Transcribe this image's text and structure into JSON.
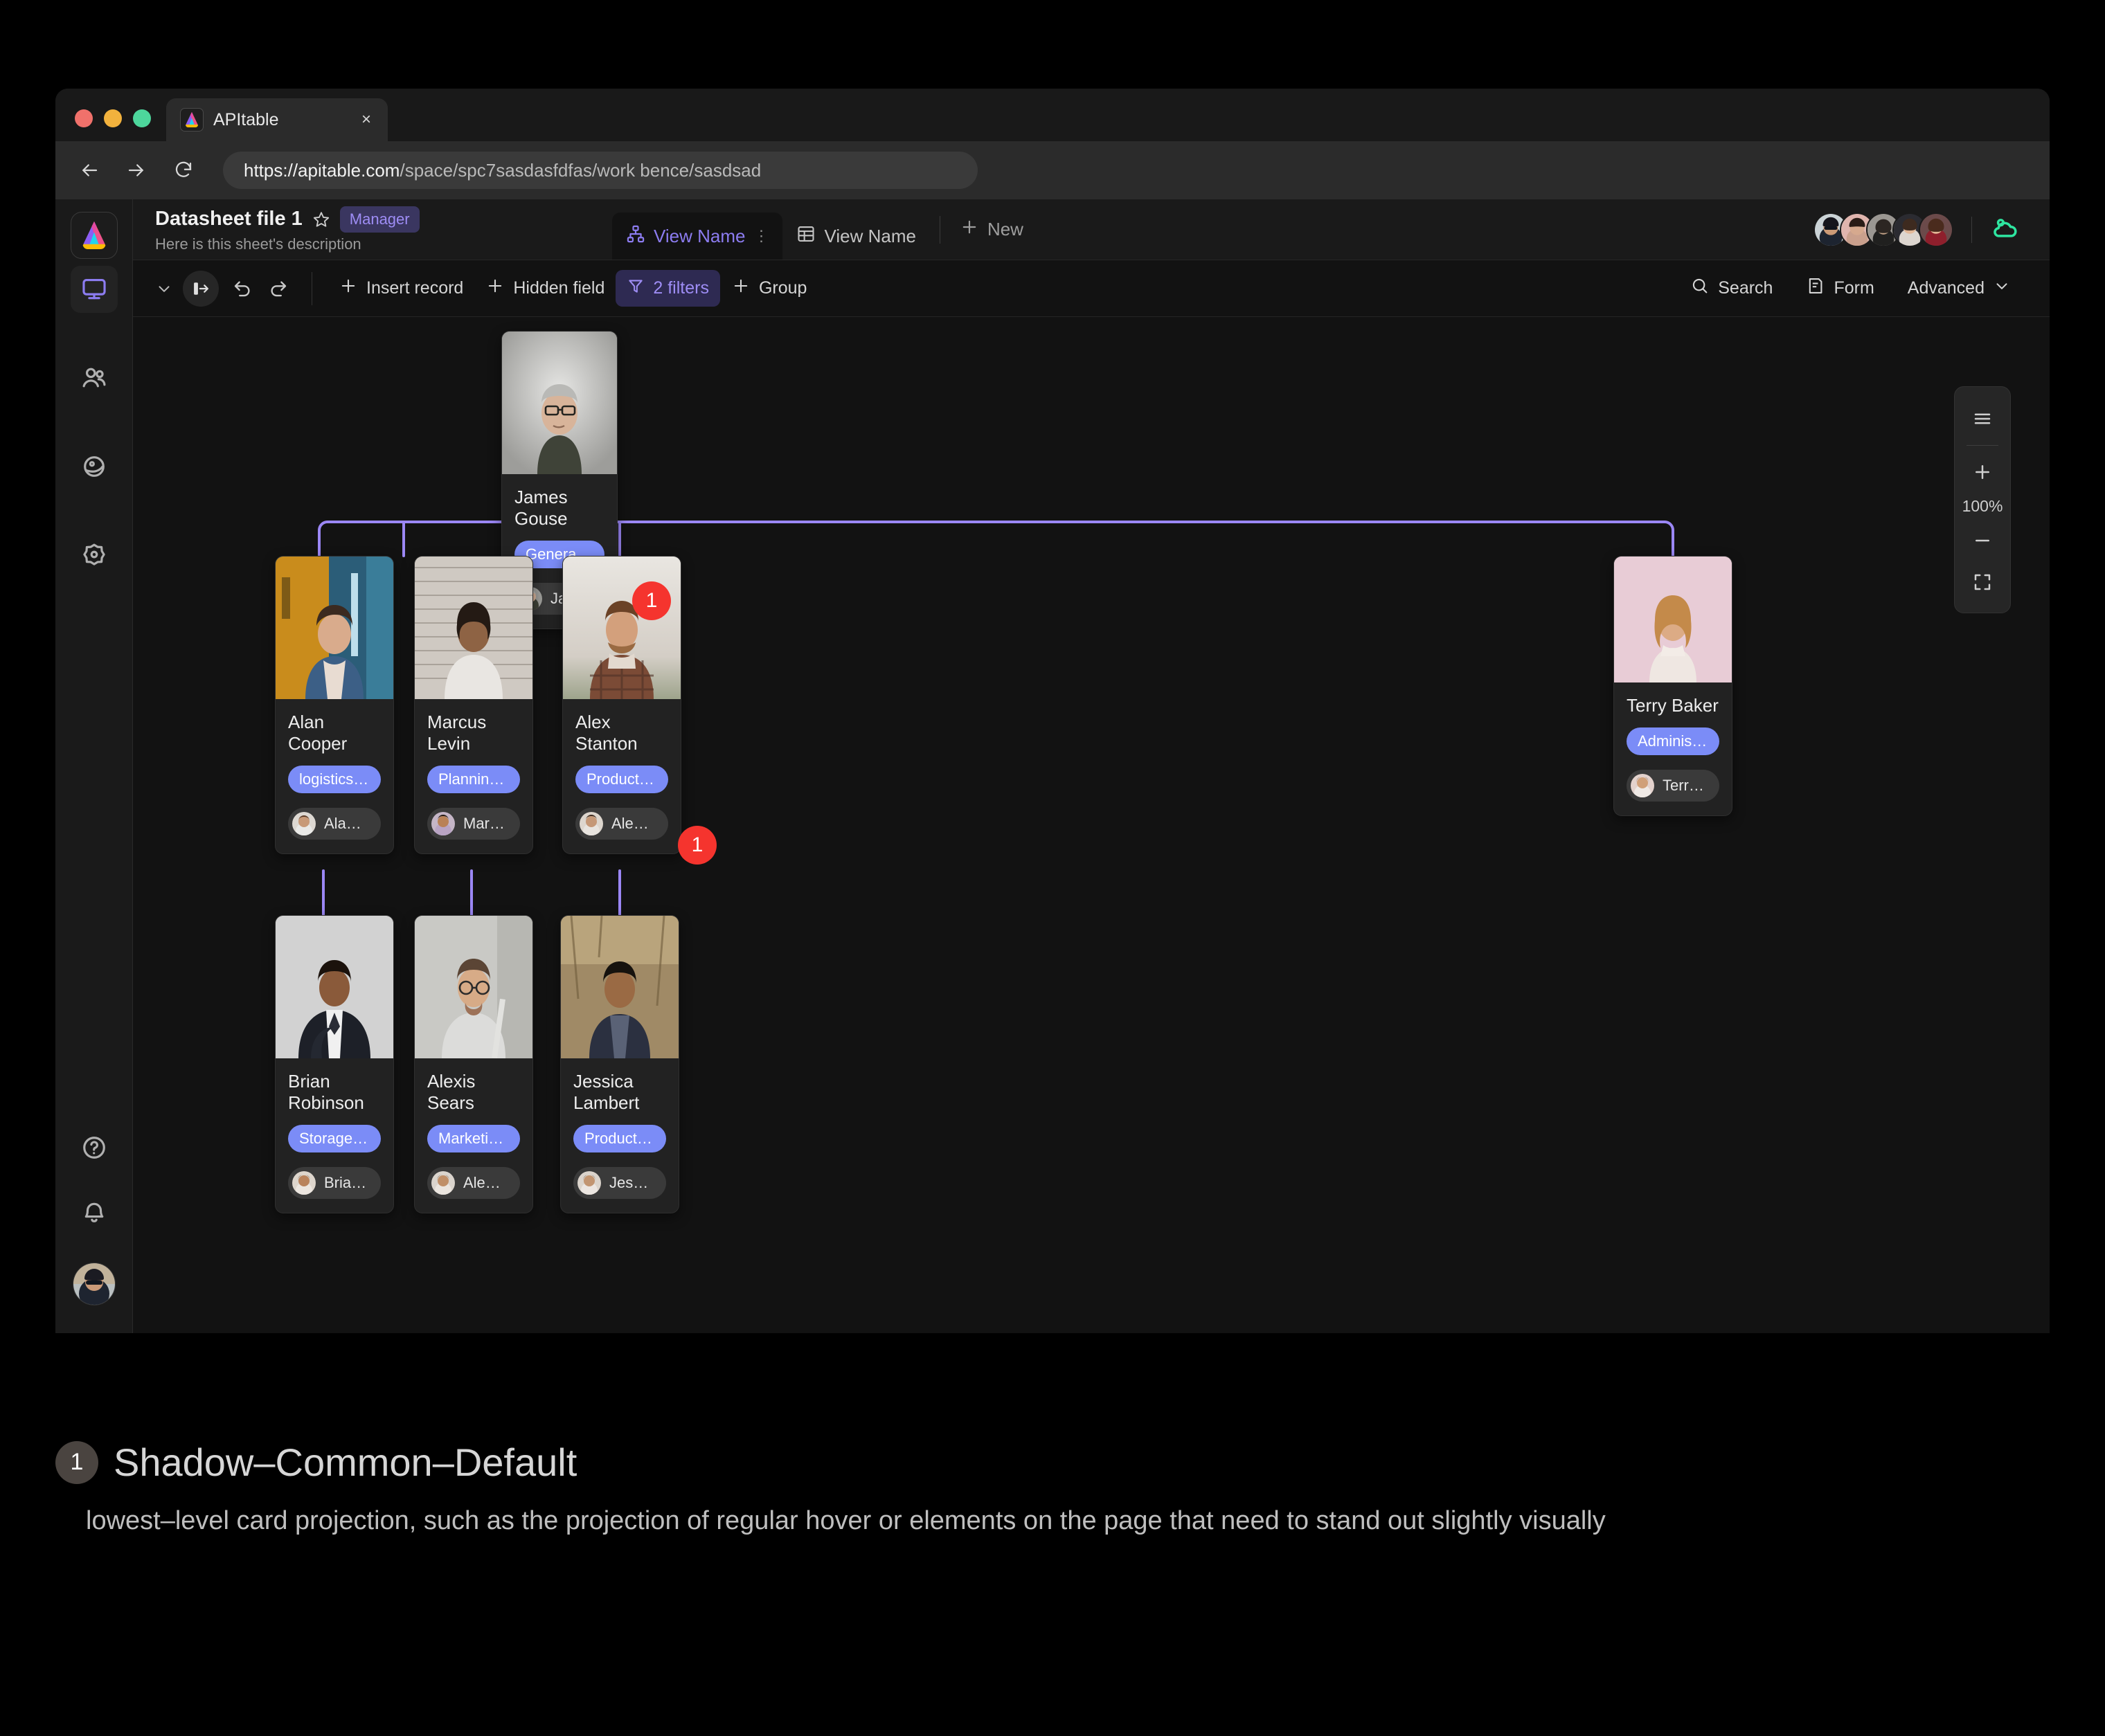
{
  "browser": {
    "tab": {
      "title": "APItable",
      "favicon": "apitable-logo-icon",
      "close": "×"
    },
    "nav": {
      "back": "back-arrow-icon",
      "forward": "forward-arrow-icon",
      "reload": "reload-icon"
    },
    "url": {
      "strong": "https://apitable.com",
      "rest": "/space/spc7sasdasfdfas/work bence/sasdsad"
    }
  },
  "rail": {
    "items": [
      {
        "name": "workbench",
        "icon": "monitor-icon",
        "active": true
      },
      {
        "name": "contacts",
        "icon": "people-icon",
        "active": false
      },
      {
        "name": "space",
        "icon": "planet-icon",
        "active": false
      },
      {
        "name": "settings",
        "icon": "gear-icon",
        "active": false
      }
    ],
    "bottom": [
      {
        "name": "help",
        "icon": "question-circle-icon"
      },
      {
        "name": "notifications",
        "icon": "bell-icon"
      }
    ]
  },
  "header": {
    "sheet_title": "Datasheet file 1",
    "star": "star-icon",
    "role_badge": "Manager",
    "description": "Here is this sheet's description",
    "view_tabs": [
      {
        "label": "View Name",
        "icon": "org-chart-icon",
        "active": true,
        "menu": "⋮"
      },
      {
        "label": "View Name",
        "icon": "grid-icon",
        "active": false
      }
    ],
    "new_view": {
      "label": "New",
      "icon": "plus-icon"
    },
    "collaborators_count": 5,
    "cloud_status_icon": "cloud-saved-icon",
    "cloud_color": "#2ee5a0"
  },
  "toolbar": {
    "chevron": "chevron-down-icon",
    "collapse": "collapse-panel-icon",
    "undo": "undo-icon",
    "redo": "redo-icon",
    "left_buttons": [
      {
        "label": "Insert record",
        "icon": "plus-icon",
        "accent": false
      },
      {
        "label": "Hidden field",
        "icon": "plus-icon",
        "accent": false
      },
      {
        "label": "2 filters",
        "icon": "filter-icon",
        "accent": true
      },
      {
        "label": "Group",
        "icon": "plus-icon",
        "accent": false
      }
    ],
    "right_buttons": [
      {
        "label": "Search",
        "icon": "search-icon"
      },
      {
        "label": "Form",
        "icon": "form-icon"
      },
      {
        "label": "Advanced",
        "icon": "chevron-down-icon"
      }
    ]
  },
  "zoom_panel": {
    "menu_icon": "hamburger-icon",
    "zoom_in_icon": "plus-icon",
    "zoom_level": "100%",
    "zoom_out_icon": "minus-icon",
    "fit_icon": "fullscreen-icon"
  },
  "org_chart": {
    "link_color": "#9b87f5",
    "nodes": [
      {
        "id": "james",
        "name": "James Gouse",
        "role": "General Manager",
        "member": "James Gouse",
        "badge": "1",
        "photo_tone": "#b8b8b4",
        "avatar_tone": "#8e8e88"
      },
      {
        "id": "alan",
        "name": "Alan Cooper",
        "role": "logistics center",
        "member": "Alan Cooper",
        "badge": null,
        "photo_tone": "#3d6a88",
        "avatar_tone": "#b4a695"
      },
      {
        "id": "marcus",
        "name": "Marcus Levin",
        "role": "Planning Center",
        "member": "Marcus Levin",
        "badge": null,
        "photo_tone": "#b9b3ad",
        "avatar_tone": "#b8a48f"
      },
      {
        "id": "alex",
        "name": "Alex Stanton",
        "role": "Production Manage...",
        "member": "Alex Stanton",
        "badge": "1",
        "photo_tone": "#ddd8d2",
        "avatar_tone": "#c0b4a8"
      },
      {
        "id": "terry",
        "name": "Terry Baker",
        "role": "Administration",
        "member": "Terry Baker",
        "badge": null,
        "photo_tone": "#e6cdd6",
        "avatar_tone": "#d3b9b0"
      },
      {
        "id": "brian",
        "name": "Brian Robinson",
        "role": "Storage Department",
        "member": "Brian Robinson",
        "badge": null,
        "photo_tone": "#cfcfcf",
        "avatar_tone": "#b3a494"
      },
      {
        "id": "alexis",
        "name": "Alexis Sears",
        "role": "Marketing department",
        "member": "Alexis Sears",
        "badge": null,
        "photo_tone": "#cbcbc7",
        "avatar_tone": "#b9a894"
      },
      {
        "id": "jessica",
        "name": "Jessica Lambert",
        "role": "Production departm...",
        "member": "Jessica Lambert",
        "badge": null,
        "photo_tone": "#9d8565",
        "avatar_tone": "#b0a190"
      }
    ]
  },
  "caption": {
    "badge": "1",
    "title": "Shadow–Common–Default",
    "body": "lowest–level card projection, such as the projection of regular hover or elements on the page that need to stand out slightly visually"
  }
}
